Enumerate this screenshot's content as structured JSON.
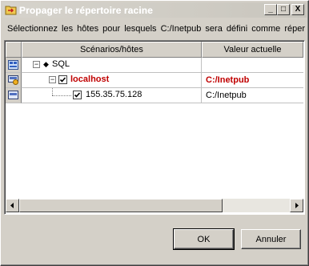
{
  "window": {
    "title": "Propager le répertoire racine",
    "icon": "folder-propagate-icon",
    "controls": {
      "minimize": "_",
      "maximize": "□",
      "close": "X"
    }
  },
  "instruction": "Sélectionnez les hôtes pour lesquels C:/Inetpub sera défini comme répert",
  "grid": {
    "columns": [
      "Scénarios/hôtes",
      "Valeur actuelle"
    ],
    "rows": [
      {
        "name": "SQL",
        "value": "",
        "level": 0,
        "icon": "scenario-icon",
        "checked": null,
        "expanded": true
      },
      {
        "name": "localhost",
        "value": "C:/Inetpub",
        "level": 1,
        "icon": "master-host-icon",
        "checked": true,
        "expanded": true,
        "highlight": "#c00000"
      },
      {
        "name": "155.35.75.128",
        "value": "C:/Inetpub",
        "level": 2,
        "icon": "replica-host-icon",
        "checked": true,
        "expanded": null
      }
    ]
  },
  "buttons": {
    "ok": "OK",
    "cancel": "Annuler"
  },
  "colors": {
    "highlight": "#c00000",
    "face": "#d4d0c8"
  }
}
